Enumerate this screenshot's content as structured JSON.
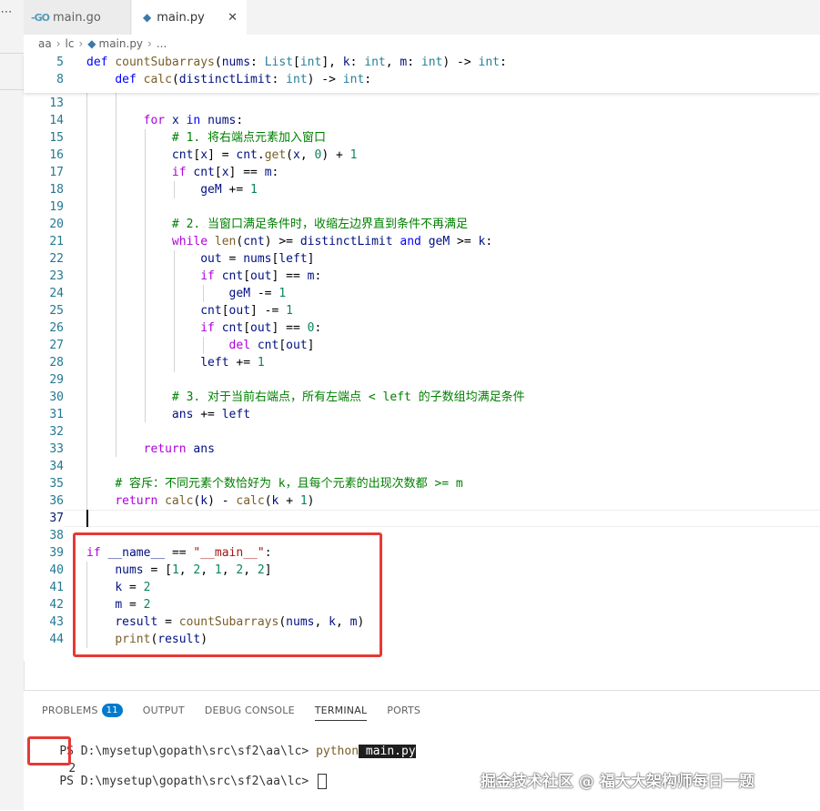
{
  "tabs": [
    {
      "icon": "go-icon",
      "label": "main.go"
    },
    {
      "icon": "python-icon",
      "label": "main.py",
      "close": "✕"
    }
  ],
  "breadcrumb": [
    "aa",
    "lc",
    "main.py",
    "..."
  ],
  "sticky": [
    {
      "ln": "5",
      "tokens": [
        [
          "kw",
          "def "
        ],
        [
          "fn",
          "countSubarrays"
        ],
        [
          "op",
          "("
        ],
        [
          "vr",
          "nums"
        ],
        [
          "op",
          ": "
        ],
        [
          "ty",
          "List"
        ],
        [
          "op",
          "["
        ],
        [
          "ty",
          "int"
        ],
        [
          "op",
          "], "
        ],
        [
          "vr",
          "k"
        ],
        [
          "op",
          ": "
        ],
        [
          "ty",
          "int"
        ],
        [
          "op",
          ", "
        ],
        [
          "vr",
          "m"
        ],
        [
          "op",
          ": "
        ],
        [
          "ty",
          "int"
        ],
        [
          "op",
          ") -> "
        ],
        [
          "ty",
          "int"
        ],
        [
          "op",
          ":"
        ]
      ]
    },
    {
      "ln": "8",
      "tokens": [
        [
          "op",
          "    "
        ],
        [
          "kw",
          "def "
        ],
        [
          "fn",
          "calc"
        ],
        [
          "op",
          "("
        ],
        [
          "vr",
          "distinctLimit"
        ],
        [
          "op",
          ": "
        ],
        [
          "ty",
          "int"
        ],
        [
          "op",
          ") -> "
        ],
        [
          "ty",
          "int"
        ],
        [
          "op",
          ":"
        ]
      ]
    }
  ],
  "lines": [
    {
      "ln": "13",
      "tokens": []
    },
    {
      "ln": "14",
      "tokens": [
        [
          "op",
          "        "
        ],
        [
          "kw2",
          "for "
        ],
        [
          "vr",
          "x "
        ],
        [
          "kw",
          "in "
        ],
        [
          "vr",
          "nums"
        ],
        [
          "op",
          ":"
        ]
      ]
    },
    {
      "ln": "15",
      "tokens": [
        [
          "op",
          "            "
        ],
        [
          "cm",
          "# 1. 将右端点元素加入窗口"
        ]
      ]
    },
    {
      "ln": "16",
      "tokens": [
        [
          "op",
          "            "
        ],
        [
          "vr",
          "cnt"
        ],
        [
          "op",
          "["
        ],
        [
          "vr",
          "x"
        ],
        [
          "op",
          "] = "
        ],
        [
          "vr",
          "cnt"
        ],
        [
          "op",
          "."
        ],
        [
          "fn",
          "get"
        ],
        [
          "op",
          "("
        ],
        [
          "vr",
          "x"
        ],
        [
          "op",
          ", "
        ],
        [
          "nm",
          "0"
        ],
        [
          "op",
          ") + "
        ],
        [
          "nm",
          "1"
        ]
      ]
    },
    {
      "ln": "17",
      "tokens": [
        [
          "op",
          "            "
        ],
        [
          "kw2",
          "if "
        ],
        [
          "vr",
          "cnt"
        ],
        [
          "op",
          "["
        ],
        [
          "vr",
          "x"
        ],
        [
          "op",
          "] == "
        ],
        [
          "vr",
          "m"
        ],
        [
          "op",
          ":"
        ]
      ]
    },
    {
      "ln": "18",
      "tokens": [
        [
          "op",
          "                "
        ],
        [
          "vr",
          "geM "
        ],
        [
          "op",
          "+= "
        ],
        [
          "nm",
          "1"
        ]
      ]
    },
    {
      "ln": "19",
      "tokens": []
    },
    {
      "ln": "20",
      "tokens": [
        [
          "op",
          "            "
        ],
        [
          "cm",
          "# 2. 当窗口满足条件时，收缩左边界直到条件不再满足"
        ]
      ]
    },
    {
      "ln": "21",
      "tokens": [
        [
          "op",
          "            "
        ],
        [
          "kw2",
          "while "
        ],
        [
          "fn",
          "len"
        ],
        [
          "op",
          "("
        ],
        [
          "vr",
          "cnt"
        ],
        [
          "op",
          ") >= "
        ],
        [
          "vr",
          "distinctLimit "
        ],
        [
          "kw",
          "and "
        ],
        [
          "vr",
          "geM "
        ],
        [
          "op",
          ">= "
        ],
        [
          "vr",
          "k"
        ],
        [
          "op",
          ":"
        ]
      ]
    },
    {
      "ln": "22",
      "tokens": [
        [
          "op",
          "                "
        ],
        [
          "vr",
          "out "
        ],
        [
          "op",
          "= "
        ],
        [
          "vr",
          "nums"
        ],
        [
          "op",
          "["
        ],
        [
          "vr",
          "left"
        ],
        [
          "op",
          "]"
        ]
      ]
    },
    {
      "ln": "23",
      "tokens": [
        [
          "op",
          "                "
        ],
        [
          "kw2",
          "if "
        ],
        [
          "vr",
          "cnt"
        ],
        [
          "op",
          "["
        ],
        [
          "vr",
          "out"
        ],
        [
          "op",
          "] == "
        ],
        [
          "vr",
          "m"
        ],
        [
          "op",
          ":"
        ]
      ]
    },
    {
      "ln": "24",
      "tokens": [
        [
          "op",
          "                    "
        ],
        [
          "vr",
          "geM "
        ],
        [
          "op",
          "-= "
        ],
        [
          "nm",
          "1"
        ]
      ]
    },
    {
      "ln": "25",
      "tokens": [
        [
          "op",
          "                "
        ],
        [
          "vr",
          "cnt"
        ],
        [
          "op",
          "["
        ],
        [
          "vr",
          "out"
        ],
        [
          "op",
          "] -= "
        ],
        [
          "nm",
          "1"
        ]
      ]
    },
    {
      "ln": "26",
      "tokens": [
        [
          "op",
          "                "
        ],
        [
          "kw2",
          "if "
        ],
        [
          "vr",
          "cnt"
        ],
        [
          "op",
          "["
        ],
        [
          "vr",
          "out"
        ],
        [
          "op",
          "] == "
        ],
        [
          "nm",
          "0"
        ],
        [
          "op",
          ":"
        ]
      ]
    },
    {
      "ln": "27",
      "tokens": [
        [
          "op",
          "                    "
        ],
        [
          "kw2",
          "del "
        ],
        [
          "vr",
          "cnt"
        ],
        [
          "op",
          "["
        ],
        [
          "vr",
          "out"
        ],
        [
          "op",
          "]"
        ]
      ]
    },
    {
      "ln": "28",
      "tokens": [
        [
          "op",
          "                "
        ],
        [
          "vr",
          "left "
        ],
        [
          "op",
          "+= "
        ],
        [
          "nm",
          "1"
        ]
      ]
    },
    {
      "ln": "29",
      "tokens": []
    },
    {
      "ln": "30",
      "tokens": [
        [
          "op",
          "            "
        ],
        [
          "cm",
          "# 3. 对于当前右端点，所有左端点 < left 的子数组均满足条件"
        ]
      ]
    },
    {
      "ln": "31",
      "tokens": [
        [
          "op",
          "            "
        ],
        [
          "vr",
          "ans "
        ],
        [
          "op",
          "+= "
        ],
        [
          "vr",
          "left"
        ]
      ]
    },
    {
      "ln": "32",
      "tokens": []
    },
    {
      "ln": "33",
      "tokens": [
        [
          "op",
          "        "
        ],
        [
          "kw2",
          "return "
        ],
        [
          "vr",
          "ans"
        ]
      ]
    },
    {
      "ln": "34",
      "tokens": []
    },
    {
      "ln": "35",
      "tokens": [
        [
          "op",
          "    "
        ],
        [
          "cm",
          "# 容斥：不同元素个数恰好为 k，且每个元素的出现次数都 >= m"
        ]
      ]
    },
    {
      "ln": "36",
      "tokens": [
        [
          "op",
          "    "
        ],
        [
          "kw2",
          "return "
        ],
        [
          "fn",
          "calc"
        ],
        [
          "op",
          "("
        ],
        [
          "vr",
          "k"
        ],
        [
          "op",
          ") - "
        ],
        [
          "fn",
          "calc"
        ],
        [
          "op",
          "("
        ],
        [
          "vr",
          "k "
        ],
        [
          "op",
          "+ "
        ],
        [
          "nm",
          "1"
        ],
        [
          "op",
          ")"
        ]
      ]
    },
    {
      "ln": "37",
      "tokens": []
    },
    {
      "ln": "38",
      "tokens": []
    },
    {
      "ln": "39",
      "tokens": [
        [
          "kw2",
          "if "
        ],
        [
          "vr",
          "__name__ "
        ],
        [
          "op",
          "== "
        ],
        [
          "st",
          "\"__main__\""
        ],
        [
          "op",
          ":"
        ]
      ]
    },
    {
      "ln": "40",
      "tokens": [
        [
          "op",
          "    "
        ],
        [
          "vr",
          "nums "
        ],
        [
          "op",
          "= ["
        ],
        [
          "nm",
          "1"
        ],
        [
          "op",
          ", "
        ],
        [
          "nm",
          "2"
        ],
        [
          "op",
          ", "
        ],
        [
          "nm",
          "1"
        ],
        [
          "op",
          ", "
        ],
        [
          "nm",
          "2"
        ],
        [
          "op",
          ", "
        ],
        [
          "nm",
          "2"
        ],
        [
          "op",
          "]"
        ]
      ]
    },
    {
      "ln": "41",
      "tokens": [
        [
          "op",
          "    "
        ],
        [
          "vr",
          "k "
        ],
        [
          "op",
          "= "
        ],
        [
          "nm",
          "2"
        ]
      ]
    },
    {
      "ln": "42",
      "tokens": [
        [
          "op",
          "    "
        ],
        [
          "vr",
          "m "
        ],
        [
          "op",
          "= "
        ],
        [
          "nm",
          "2"
        ]
      ]
    },
    {
      "ln": "43",
      "tokens": [
        [
          "op",
          "    "
        ],
        [
          "vr",
          "result "
        ],
        [
          "op",
          "= "
        ],
        [
          "fn",
          "countSubarrays"
        ],
        [
          "op",
          "("
        ],
        [
          "vr",
          "nums"
        ],
        [
          "op",
          ", "
        ],
        [
          "vr",
          "k"
        ],
        [
          "op",
          ", "
        ],
        [
          "vr",
          "m"
        ],
        [
          "op",
          ")"
        ]
      ]
    },
    {
      "ln": "44",
      "tokens": [
        [
          "op",
          "    "
        ],
        [
          "fn",
          "print"
        ],
        [
          "op",
          "("
        ],
        [
          "vr",
          "result"
        ],
        [
          "op",
          ")"
        ]
      ]
    }
  ],
  "panel": {
    "tabs": [
      "PROBLEMS",
      "OUTPUT",
      "DEBUG CONSOLE",
      "TERMINAL",
      "PORTS"
    ],
    "problems_count": "11",
    "active_tab": "TERMINAL"
  },
  "terminal": {
    "prompt": "PS D:\\mysetup\\gopath\\src\\sf2\\aa\\lc> ",
    "command": "python",
    "arg": " main.py",
    "output": "2"
  },
  "watermark": "掘金技术社区 @ 福大大架构师每日一题"
}
